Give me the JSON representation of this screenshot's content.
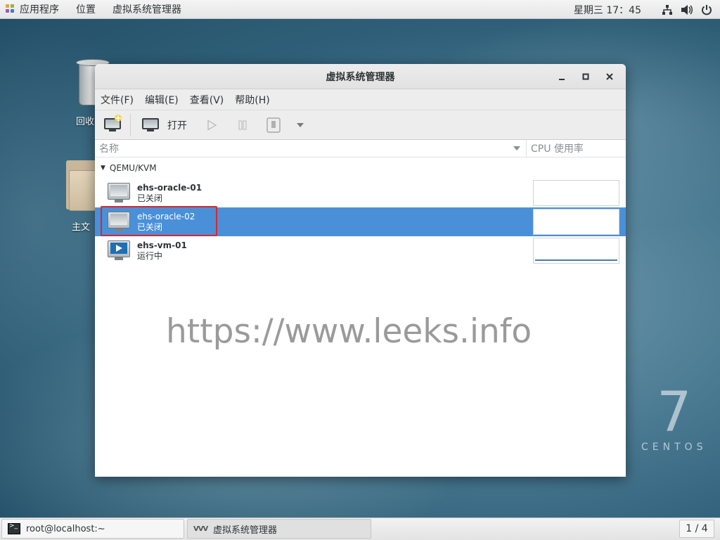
{
  "top_panel": {
    "apps_label": "应用程序",
    "places_label": "位置",
    "active_app_label": "虚拟系统管理器",
    "clock": "星期三 17：45"
  },
  "desktop": {
    "trash_label": "回收站",
    "home_label": "主文件夹",
    "trash_label_visible": "回收",
    "home_label_visible": "主文",
    "centos_number": "7",
    "centos_text": "CENTOS"
  },
  "window": {
    "title": "虚拟系统管理器",
    "menu": [
      "文件(F)",
      "编辑(E)",
      "查看(V)",
      "帮助(H)"
    ],
    "toolbar": {
      "open_label": "打开"
    },
    "columns": {
      "name": "名称",
      "cpu": "CPU 使用率"
    },
    "group": "QEMU/KVM",
    "vms": [
      {
        "name": "ehs-oracle-01",
        "status": "已关闭",
        "icon": "vm-off-icon"
      },
      {
        "name": "ehs-oracle-02",
        "status": "已关闭",
        "icon": "vm-off-icon",
        "selected": true
      },
      {
        "name": "ehs-vm-01",
        "status": "运行中",
        "icon": "vm-running-icon"
      }
    ]
  },
  "watermark": "https://www.leeks.info",
  "bottom_panel": {
    "terminal_task": "root@localhost:~",
    "vmm_task": "虚拟系统管理器",
    "workspace": "1 / 4"
  },
  "colors": {
    "selection": "#4a90d9",
    "highlight_box": "#d9262c"
  }
}
